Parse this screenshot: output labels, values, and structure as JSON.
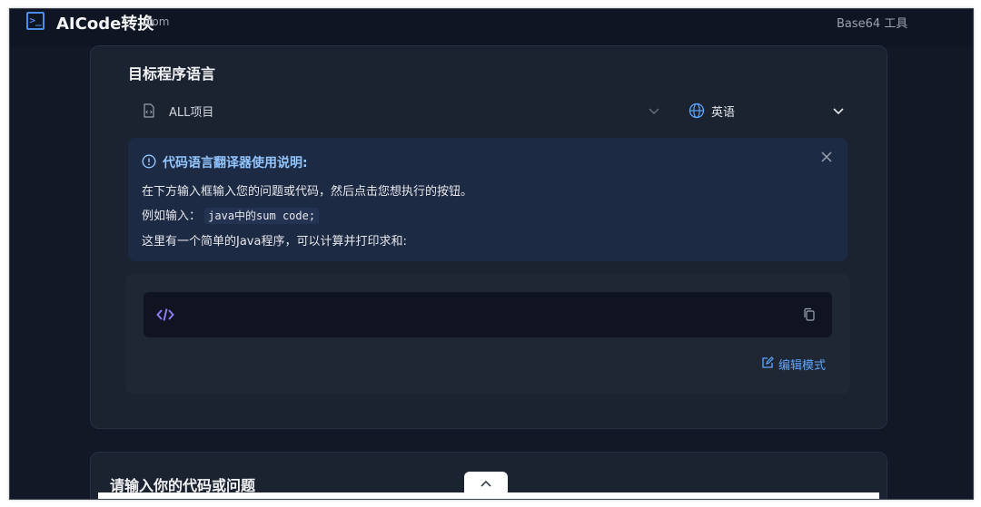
{
  "header": {
    "logo_text": "AICode转换",
    "logo_tld": ".com",
    "nav_link": "Base64 工具"
  },
  "translator": {
    "section_title": "目标程序语言",
    "project_select": "ALL项目",
    "language_select": "英语"
  },
  "alert": {
    "title": "代码语言翻译器使用说明:",
    "line1": "在下方输入框输入您的问题或代码，然后点击您想执行的按钮。",
    "line2_prefix": "例如输入：",
    "line2_code": "java中的sum code;",
    "line3": "这里有一个简单的Java程序，可以计算并打印求和:"
  },
  "editor": {
    "edit_mode_label": "编辑模式"
  },
  "input_section": {
    "title": "请输入你的代码或问题"
  },
  "colors": {
    "accent": "#4a8eea",
    "background": "#121826",
    "card": "#1b2230",
    "alert_bg": "#1d2a44",
    "link": "#60a5fa"
  }
}
